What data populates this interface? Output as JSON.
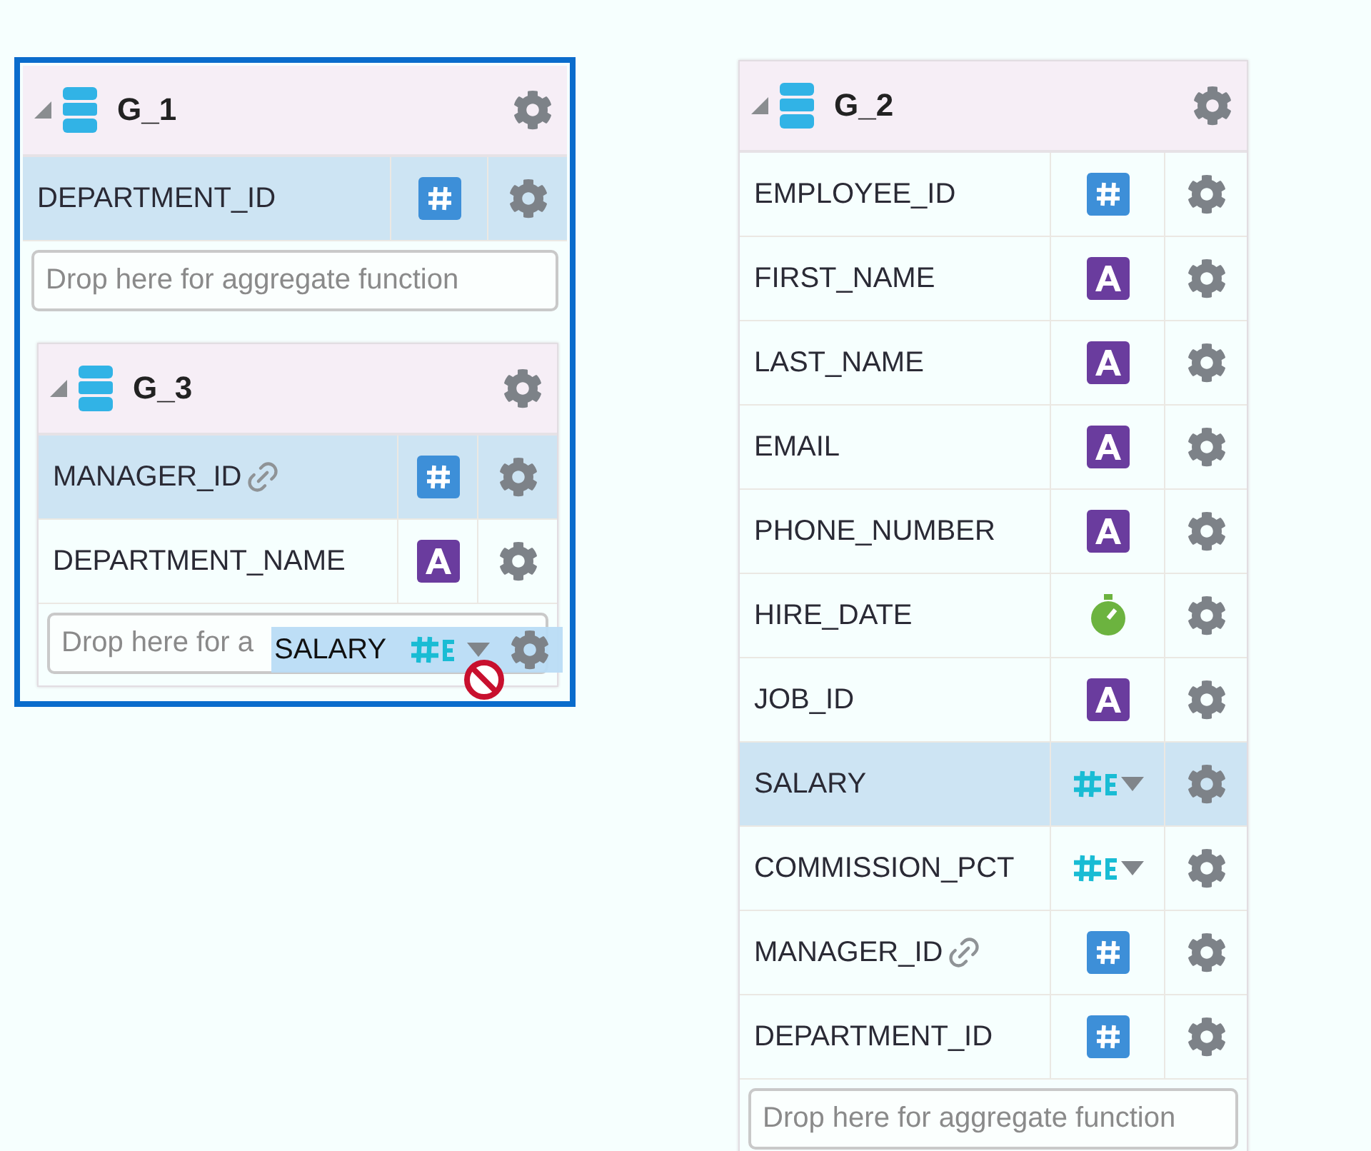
{
  "groups": [
    {
      "name": "G_1",
      "expanded": true,
      "focused": true,
      "columns": [
        {
          "name": "DEPARTMENT_ID",
          "kind": "number",
          "linked": false,
          "selected": true
        }
      ],
      "drop_zone": {
        "placeholder": "Drop here for aggregate function"
      },
      "children": [
        {
          "name": "G_3",
          "expanded": true,
          "focused": false,
          "columns": [
            {
              "name": "MANAGER_ID",
              "kind": "number",
              "linked": true,
              "selected": true
            },
            {
              "name": "DEPARTMENT_NAME",
              "kind": "text",
              "linked": false,
              "selected": false
            }
          ],
          "drop_zone": {
            "placeholder": "Drop here for a"
          },
          "drag_item": {
            "name": "SALARY",
            "kind": "measure",
            "drop_allowed": false
          }
        }
      ]
    },
    {
      "name": "G_2",
      "expanded": true,
      "focused": false,
      "columns": [
        {
          "name": "EMPLOYEE_ID",
          "kind": "number",
          "linked": false,
          "selected": false
        },
        {
          "name": "FIRST_NAME",
          "kind": "text",
          "linked": false,
          "selected": false
        },
        {
          "name": "LAST_NAME",
          "kind": "text",
          "linked": false,
          "selected": false
        },
        {
          "name": "EMAIL",
          "kind": "text",
          "linked": false,
          "selected": false
        },
        {
          "name": "PHONE_NUMBER",
          "kind": "text",
          "linked": false,
          "selected": false
        },
        {
          "name": "HIRE_DATE",
          "kind": "date",
          "linked": false,
          "selected": false
        },
        {
          "name": "JOB_ID",
          "kind": "text",
          "linked": false,
          "selected": false
        },
        {
          "name": "SALARY",
          "kind": "measure",
          "linked": false,
          "selected": true
        },
        {
          "name": "COMMISSION_PCT",
          "kind": "measure",
          "linked": false,
          "selected": false
        },
        {
          "name": "MANAGER_ID",
          "kind": "number",
          "linked": true,
          "selected": false
        },
        {
          "name": "DEPARTMENT_ID",
          "kind": "number",
          "linked": false,
          "selected": false
        }
      ],
      "drop_zone": {
        "placeholder": "Drop here for aggregate function"
      }
    }
  ]
}
